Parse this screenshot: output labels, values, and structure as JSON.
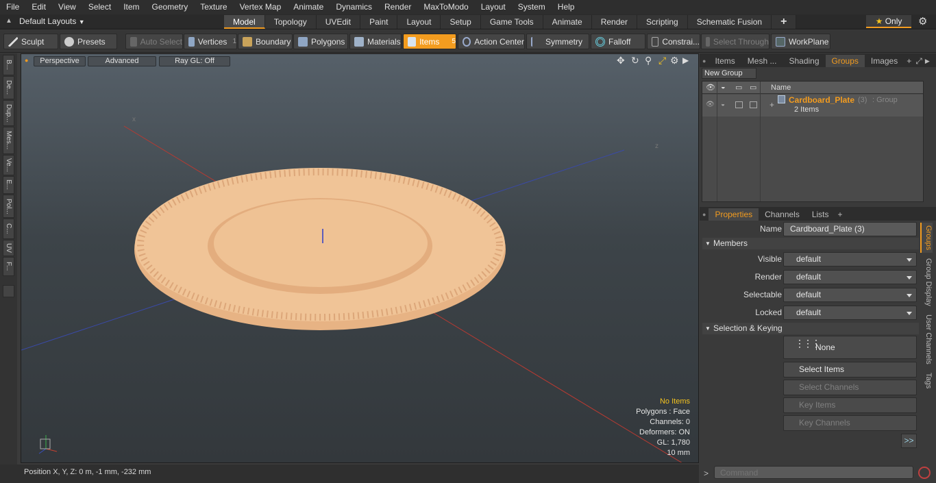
{
  "menu": [
    "File",
    "Edit",
    "View",
    "Select",
    "Item",
    "Geometry",
    "Texture",
    "Vertex Map",
    "Animate",
    "Dynamics",
    "Render",
    "MaxToModo",
    "Layout",
    "System",
    "Help"
  ],
  "layout_dropdown": "Default Layouts",
  "tabs": [
    "Model",
    "Topology",
    "UVEdit",
    "Paint",
    "Layout",
    "Setup",
    "Game Tools",
    "Animate",
    "Render",
    "Scripting",
    "Schematic Fusion"
  ],
  "active_tab": "Model",
  "only_label": "Only",
  "toolbar": {
    "sculpt": "Sculpt",
    "presets": "Presets",
    "auto_select": "Auto Select",
    "vertices": "Vertices",
    "vertices_count": "1",
    "boundary": "Boundary",
    "polygons": "Polygons",
    "materials": "Materials",
    "items": "Items",
    "items_count": "5",
    "action_center": "Action Center",
    "symmetry": "Symmetry",
    "falloff": "Falloff",
    "constraints": "Constrai...",
    "select_through": "Select Through",
    "workplane": "WorkPlane"
  },
  "left_tabs": [
    "B...",
    "De...",
    "Dup...",
    "Mes...",
    "Ve...",
    "E...",
    "Pol...",
    "C...",
    "UV",
    "F..."
  ],
  "viewport": {
    "view": "Perspective",
    "shading": "Advanced",
    "raygl": "Ray GL: Off"
  },
  "hud": {
    "selection": "No Items",
    "polygons": "Polygons : Face",
    "channels": "Channels: 0",
    "deformers": "Deformers: ON",
    "gl": "GL: 1,780",
    "scale": "10 mm"
  },
  "status": "Position X, Y, Z:  0 m, -1 mm, -232 mm",
  "panel_tabs": [
    "Items",
    "Mesh ...",
    "Shading",
    "Groups",
    "Images"
  ],
  "active_panel_tab": "Groups",
  "new_group": "New Group",
  "list_header": "Name",
  "group": {
    "name": "Cardboard_Plate",
    "count": "(3)",
    "type": ": Group",
    "items": "2 Items"
  },
  "props_tabs": [
    "Properties",
    "Channels",
    "Lists"
  ],
  "side_tabs": [
    "Groups",
    "Group Display",
    "User Channels",
    "Tags"
  ],
  "props": {
    "name_label": "Name",
    "name_value": "Cardboard_Plate (3)",
    "members": "Members",
    "visible": "Visible",
    "render": "Render",
    "selectable": "Selectable",
    "locked": "Locked",
    "dd_value": "default",
    "sel_keying": "Selection & Keying",
    "none": "None",
    "select_items": "Select Items",
    "select_channels": "Select Channels",
    "key_items": "Key Items",
    "key_channels": "Key Channels",
    "more": ">>"
  },
  "command_placeholder": "Command",
  "colors": {
    "accent": "#f39c1f",
    "plate": "#f0c497"
  }
}
